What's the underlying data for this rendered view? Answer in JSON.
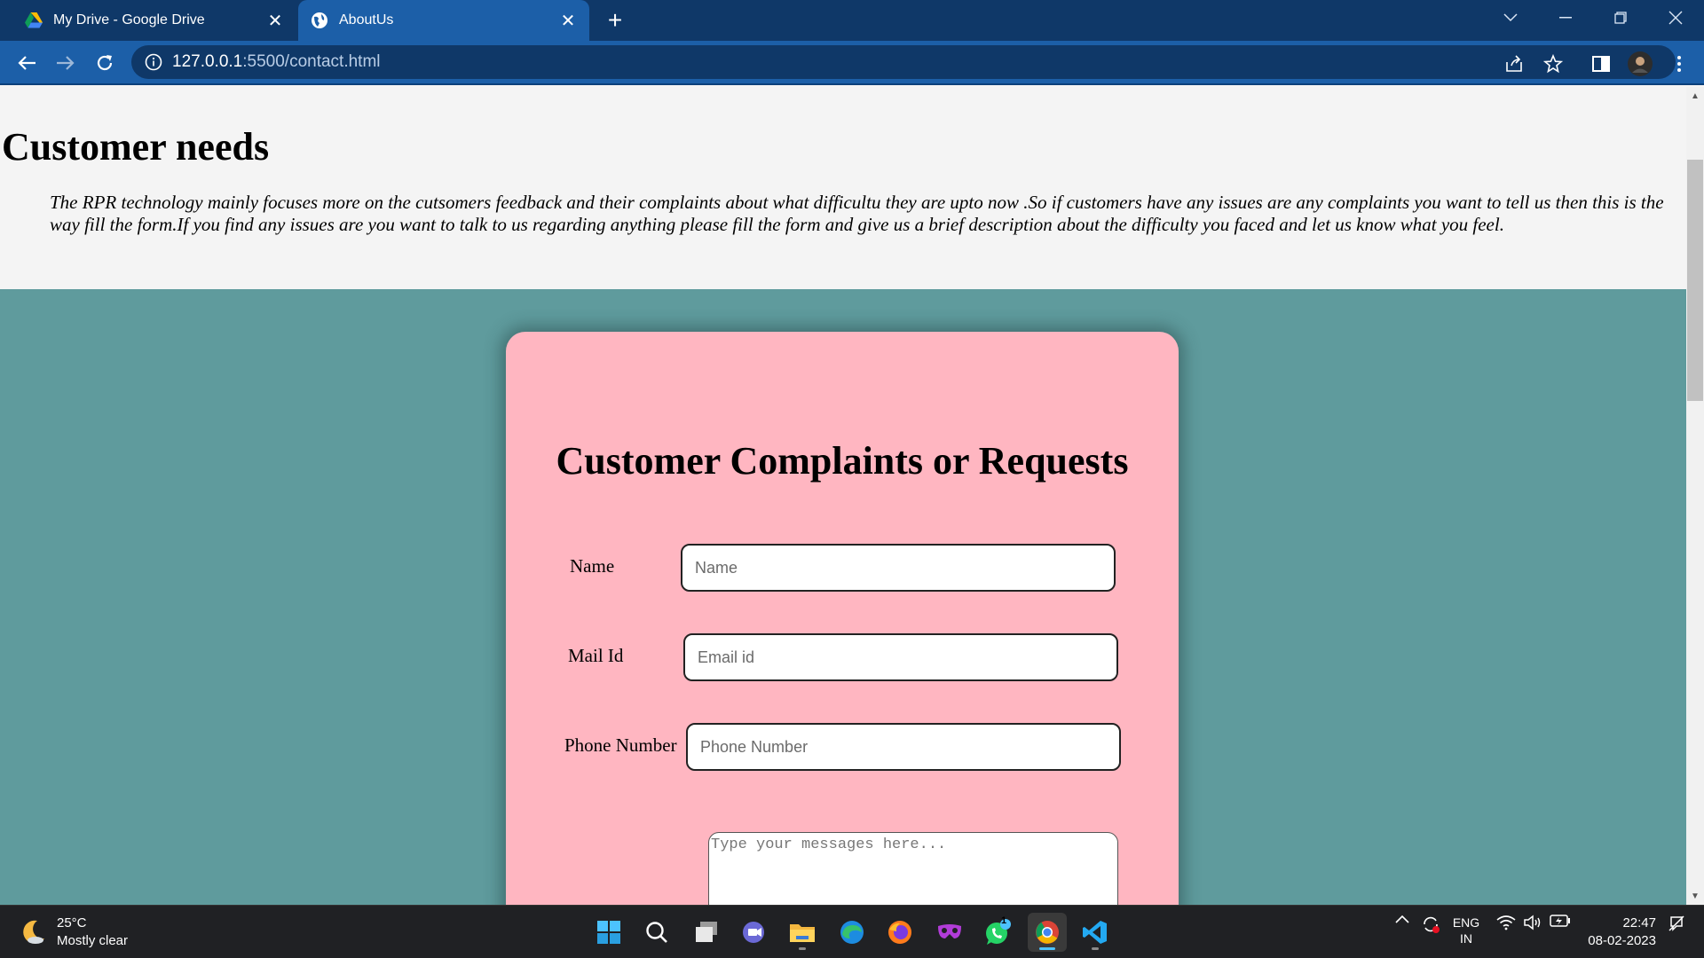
{
  "browser": {
    "tabs": [
      {
        "title": "My Drive - Google Drive",
        "icon": "google-drive-icon",
        "active": false
      },
      {
        "title": "AboutUs",
        "icon": "globe-icon",
        "active": true
      }
    ],
    "new_tab_symbol": "+",
    "url_host": "127.0.0.1",
    "url_path": ":5500/contact.html"
  },
  "page": {
    "heading": "Customer needs",
    "intro": "The RPR technology mainly focuses more on the cutsomers feedback and their complaints about what difficultu they are upto now .So if customers have any issues are any complaints you want to tell us then this is the way fill the form.If you find any issues are you want to talk to us regarding anything please fill the form and give us a brief description about the difficulty you faced and let us know what you feel."
  },
  "form": {
    "title": "Customer Complaints or Requests",
    "name_label": "Name",
    "name_placeholder": "Name",
    "email_label": "Mail Id",
    "email_placeholder": "Email id",
    "phone_label": "Phone Number",
    "phone_placeholder": "Phone Number",
    "message_placeholder": "Type your messages here..."
  },
  "taskbar": {
    "temperature": "25°C",
    "weather": "Mostly clear",
    "language": "ENG",
    "region": "IN",
    "time": "22:47",
    "date": "08-02-2023",
    "whatsapp_badge": "1"
  },
  "colors": {
    "tabbar": "#0f3868",
    "toolbar": "#1c5fa8",
    "page_bg": "#f4f4f4",
    "teal_section": "#5f9b9d",
    "card": "#ffb6c1",
    "taskbar": "#202124"
  }
}
